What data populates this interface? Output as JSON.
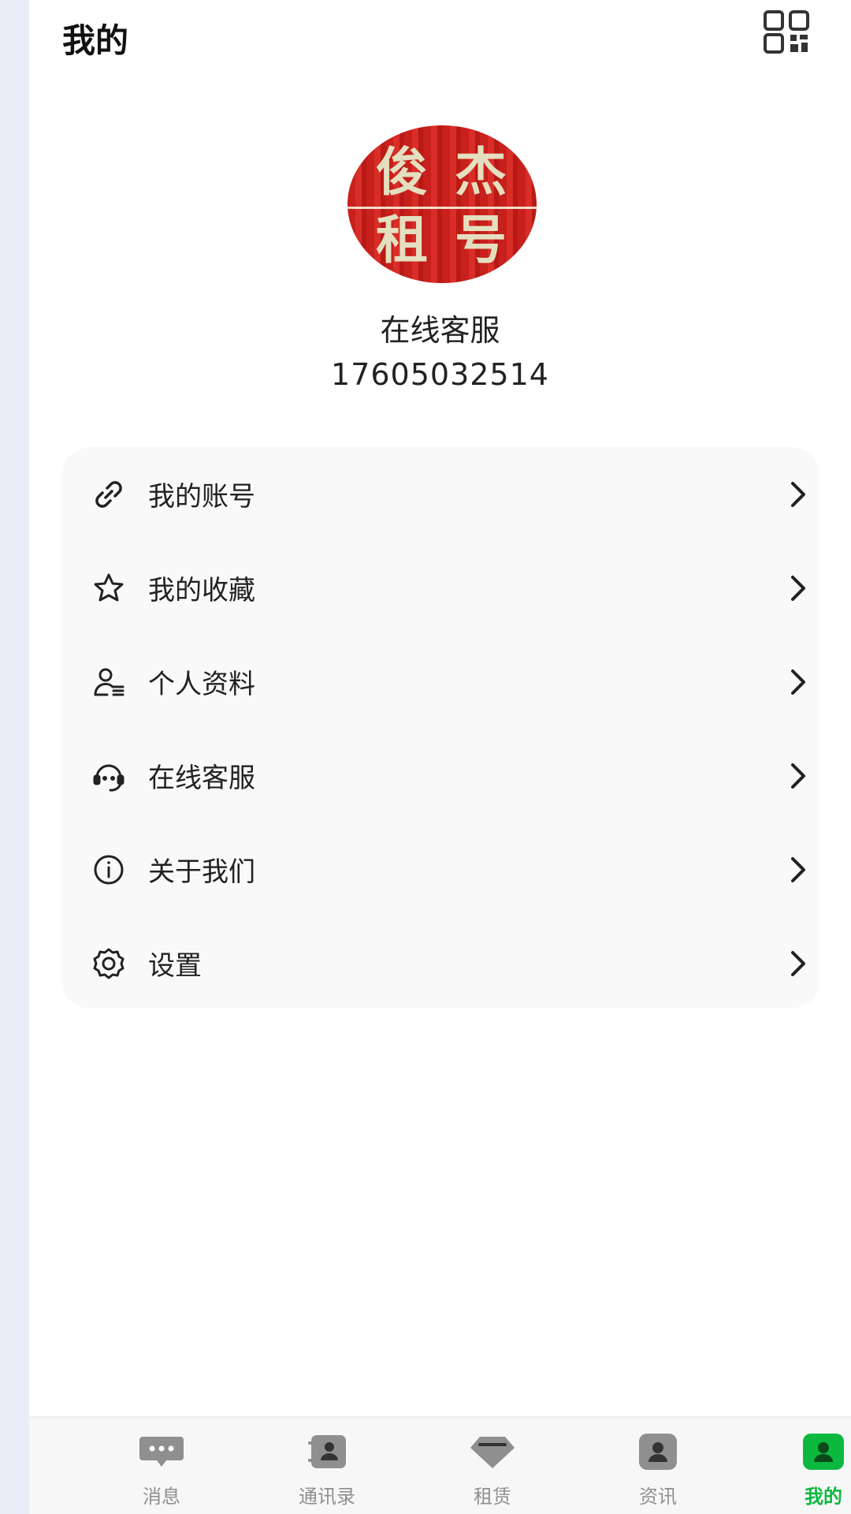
{
  "header": {
    "title": "我的",
    "qr_icon": "qr-code-icon"
  },
  "profile": {
    "avatar_text": [
      "俊",
      "杰",
      "租",
      "号"
    ],
    "name": "在线客服",
    "phone": "17605032514"
  },
  "menu": {
    "items": [
      {
        "label": "我的账号",
        "icon": "link-icon"
      },
      {
        "label": "我的收藏",
        "icon": "star-icon"
      },
      {
        "label": "个人资料",
        "icon": "profile-icon"
      },
      {
        "label": "在线客服",
        "icon": "headset-icon"
      },
      {
        "label": "关于我们",
        "icon": "info-icon"
      },
      {
        "label": "设置",
        "icon": "gear-icon"
      }
    ]
  },
  "tabbar": {
    "items": [
      {
        "label": "消息",
        "icon": "chat-icon",
        "active": false
      },
      {
        "label": "通讯录",
        "icon": "contacts-icon",
        "active": false
      },
      {
        "label": "租赁",
        "icon": "diamond-icon",
        "active": false
      },
      {
        "label": "资讯",
        "icon": "news-icon",
        "active": false
      },
      {
        "label": "我的",
        "icon": "me-icon",
        "active": true
      }
    ]
  },
  "colors": {
    "accent": "#0db83f",
    "inactive_tab": "#8f8f8f",
    "avatar_bg": "#c8201c"
  }
}
